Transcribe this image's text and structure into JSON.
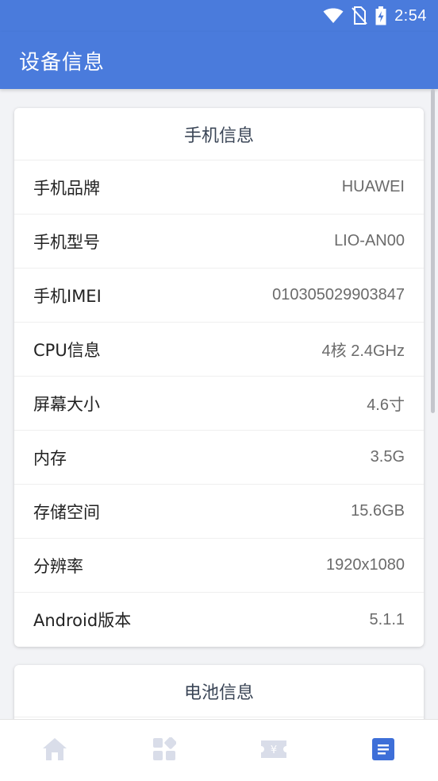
{
  "status_bar": {
    "time": "2:54",
    "icons": [
      "wifi-icon",
      "no-sim-icon",
      "battery-charging-icon"
    ]
  },
  "app_bar": {
    "title": "设备信息"
  },
  "phone_card": {
    "title": "手机信息",
    "rows": [
      {
        "label": "手机品牌",
        "value": "HUAWEI"
      },
      {
        "label": "手机型号",
        "value": "LIO-AN00"
      },
      {
        "label": "手机IMEI",
        "value": "010305029903847"
      },
      {
        "label": "CPU信息",
        "value": "4核 2.4GHz"
      },
      {
        "label": "屏幕大小",
        "value": "4.6寸"
      },
      {
        "label": "内存",
        "value": "3.5G"
      },
      {
        "label": "存储空间",
        "value": "15.6GB"
      },
      {
        "label": "分辨率",
        "value": "1920x1080"
      },
      {
        "label": "Android版本",
        "value": "5.1.1"
      }
    ]
  },
  "battery_card": {
    "title": "电池信息"
  },
  "bottom_nav": {
    "items": [
      {
        "icon": "home-icon",
        "active": false
      },
      {
        "icon": "grid-icon",
        "active": false
      },
      {
        "icon": "ticket-icon",
        "active": false
      },
      {
        "icon": "list-icon",
        "active": true
      }
    ],
    "active_color": "#3e6fd8",
    "inactive_color": "#d9dde9"
  },
  "colors": {
    "primary": "#4a7bdc"
  }
}
